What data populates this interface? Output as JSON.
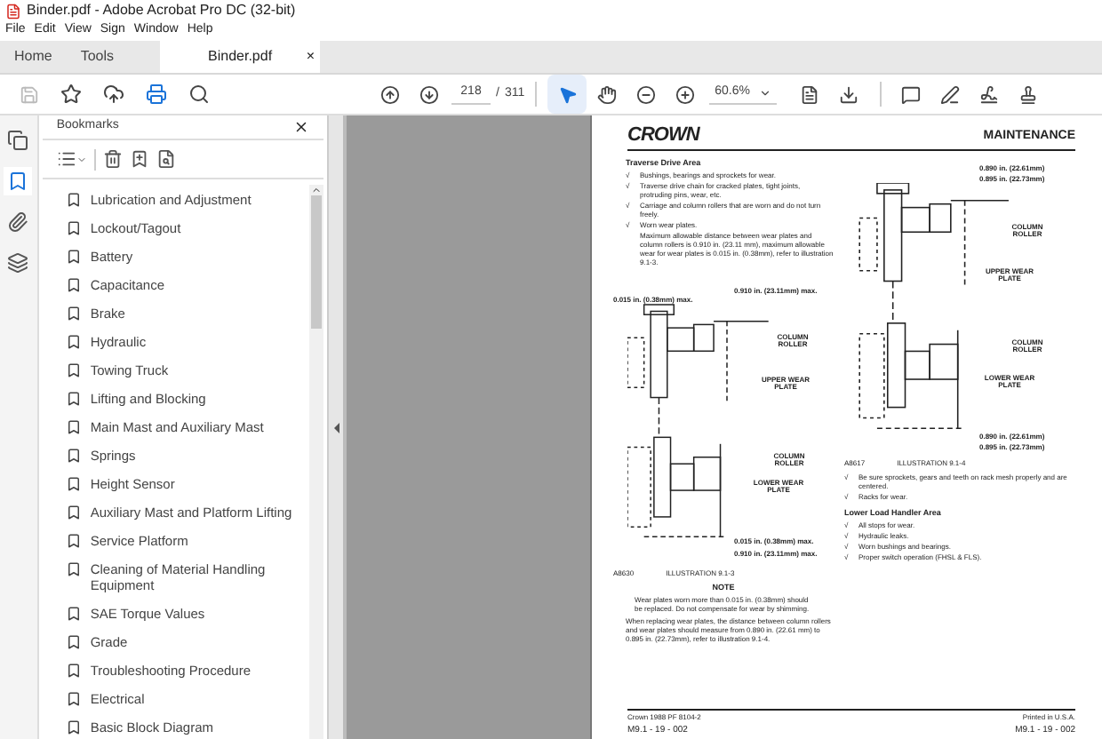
{
  "window": {
    "title": "Binder.pdf - Adobe Acrobat Pro DC (32-bit)"
  },
  "menu": [
    "File",
    "Edit",
    "View",
    "Sign",
    "Window",
    "Help"
  ],
  "tabs": [
    {
      "label": "Home",
      "selected": false
    },
    {
      "label": "Tools",
      "selected": false
    },
    {
      "label": "Binder.pdf",
      "selected": true,
      "close": "×"
    }
  ],
  "toolbar": {
    "save_disabled": true,
    "page": "218",
    "page_sep": "/",
    "page_count": "311",
    "zoom": "60.6%",
    "tools": [
      {
        "selected": true
      },
      {
        "selected": false
      }
    ]
  },
  "side_tabs": [
    {
      "selected": false
    },
    {
      "selected": true
    },
    {
      "selected": false
    },
    {
      "selected": false
    }
  ],
  "bookmarks": {
    "title": "Bookmarks",
    "items": [
      {
        "label": "Lubrication and Adjustment"
      },
      {
        "label": "Lockout/Tagout"
      },
      {
        "label": "Battery"
      },
      {
        "label": "Capacitance"
      },
      {
        "label": "Brake"
      },
      {
        "label": "Hydraulic"
      },
      {
        "label": "Towing Truck"
      },
      {
        "label": "Lifting and Blocking"
      },
      {
        "label": "Main Mast and Auxiliary Mast"
      },
      {
        "label": "Springs"
      },
      {
        "label": "Height Sensor"
      },
      {
        "label": "Auxiliary Mast and Platform Lifting"
      },
      {
        "label": "Service Platform"
      },
      {
        "label": "Cleaning of Material Handling Equipment"
      },
      {
        "label": "SAE Torque Values"
      },
      {
        "label": "Grade"
      },
      {
        "label": "Troubleshooting Procedure"
      },
      {
        "label": "Electrical"
      },
      {
        "label": "Basic Block Diagram"
      }
    ]
  },
  "document": {
    "logo": "CROWN",
    "section": "MAINTENANCE",
    "left": {
      "heading": "Traverse Drive Area",
      "checks": [
        {
          "mark": "√",
          "text": "Bushings, bearings and sprockets for wear."
        },
        {
          "mark": "√",
          "text": "Traverse drive chain for cracked plates, tight joints, protruding pins, wear, etc."
        },
        {
          "mark": "√",
          "text": "Carriage and column rollers that are worn and do not turn freely."
        },
        {
          "mark": "√",
          "text": "Worn wear plates."
        }
      ],
      "detail": "Maximum allowable distance between wear plates and column rollers is 0.910 in. (23.11 mm), maximum allowable wear for wear plates is 0.015 in. (0.38mm), refer to illustration 9.1-3.",
      "illustration": {
        "labels": [
          "0.015 in. (0.38mm) max.",
          "0.910 in. (23.11mm) max.",
          "COLUMN ROLLER",
          "UPPER WEAR PLATE",
          "COLUMN ROLLER",
          "LOWER WEAR PLATE",
          "0.015 in. (0.38mm) max.",
          "0.910 in. (23.11mm) max."
        ],
        "code": "A8630",
        "caption": "ILLUSTRATION 9.1-3"
      },
      "note_title": "NOTE",
      "note": "Wear plates worn more than 0.015 in. (0.38mm) should be replaced. Do not compensate for wear by shimming.",
      "paragraph": "When replacing wear plates, the distance between column rollers and wear plates should measure from 0.890 in. (22.61 mm) to 0.895 in. (22.73mm), refer to illustration 9.1-4."
    },
    "right": {
      "illustration": {
        "labels": [
          "0.890 in. (22.61mm)",
          "0.895 in. (22.73mm)",
          "COLUMN ROLLER",
          "UPPER WEAR PLATE",
          "COLUMN ROLLER",
          "LOWER WEAR PLATE",
          "0.890 in. (22.61mm)",
          "0.895 in. (22.73mm)"
        ],
        "code": "A8617",
        "caption": "ILLUSTRATION 9.1-4"
      },
      "checks": [
        {
          "mark": "√",
          "text": "Be sure sprockets, gears and teeth on rack mesh properly and are centered."
        },
        {
          "mark": "√",
          "text": "Racks for wear."
        }
      ],
      "heading": "Lower Load Handler Area",
      "checks2": [
        {
          "mark": "√",
          "text": "All stops for wear."
        },
        {
          "mark": "√",
          "text": "Hydraulic leaks."
        },
        {
          "mark": "√",
          "text": "Worn bushings and bearings."
        },
        {
          "mark": "√",
          "text": "Proper switch operation (FHSL & FLS)."
        }
      ]
    },
    "footer": {
      "left_code": "Crown 1988 PF 8104-2",
      "right_code": "Printed in U.S.A.",
      "left_page": "M9.1 - 19 - 002",
      "right_page": "M9.1 - 19 - 002"
    }
  }
}
